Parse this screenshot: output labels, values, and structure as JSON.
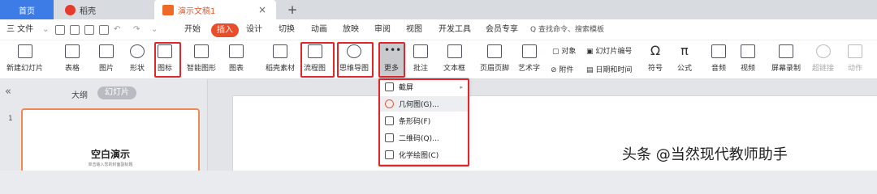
{
  "tabs": {
    "home": "首页",
    "doc": "稻壳",
    "active": "演示文稿1",
    "close": "×",
    "add": "+"
  },
  "menu": {
    "file": "三 文件",
    "start": "开始",
    "insert": "插入",
    "design": "设计",
    "switch": "切换",
    "animate": "动画",
    "show": "放映",
    "review": "审阅",
    "view": "视图",
    "devtools": "开发工具",
    "vip": "会员专享",
    "search_placeholder": "查找命令、搜索模板"
  },
  "ribbon": {
    "new_slide": "新建幻灯片",
    "table": "表格",
    "picture": "图片",
    "shape": "形状",
    "icon": "图标",
    "smart_graphic": "智能图形",
    "chart": "图表",
    "docer_material": "稻壳素材",
    "flowchart": "流程图",
    "mindmap": "思维导图",
    "more": "更多",
    "comment": "批注",
    "textbox": "文本框",
    "header_footer": "页眉页脚",
    "art_text": "艺术字",
    "object": "对象",
    "slide_number": "幻灯片编号",
    "attachment": "附件",
    "datetime": "日期和时间",
    "symbol": "符号",
    "formula": "公式",
    "audio": "音频",
    "video": "视频",
    "screen_record": "屏幕录制",
    "hyperlink": "超链接",
    "action": "动作"
  },
  "dropdown": {
    "items": [
      {
        "label": "截屏",
        "has_submenu": true
      },
      {
        "label": "几何图(G)..."
      },
      {
        "label": "条形码(F)"
      },
      {
        "label": "二维码(Q)..."
      },
      {
        "label": "化学绘图(C)"
      }
    ]
  },
  "leftpanel": {
    "collapse": "«",
    "outline": "大纲",
    "slides": "幻灯片",
    "slide_number": "1",
    "slide_title": "空白演示",
    "slide_subtitle": "单击输入您的封面副标题"
  },
  "watermark": "头条 @当然现代教师助手",
  "colors": {
    "accent_orange": "#e8572a",
    "highlight_red": "#e0262a",
    "home_blue": "#3d7be6"
  }
}
